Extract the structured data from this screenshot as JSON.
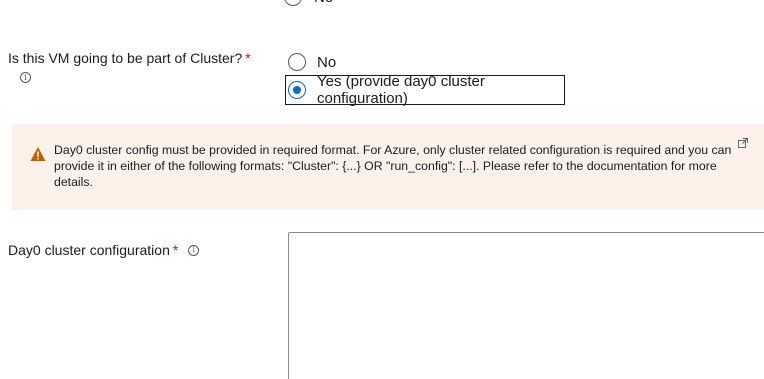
{
  "top_option": {
    "label": "No"
  },
  "cluster_question": {
    "label": "Is this VM going to be part of Cluster?",
    "required_mark": "*",
    "info_icon": "info-icon",
    "options": [
      {
        "label": "No",
        "selected": false
      },
      {
        "label": "Yes (provide day0 cluster configuration)",
        "selected": true
      }
    ]
  },
  "banner": {
    "icon": "warning-icon",
    "text": "Day0 cluster config must be provided in required format. For Azure, only cluster related configuration is required and you can provide it in either of the following formats: \"Cluster\": {...} OR \"run_config\": [...]. Please refer to the documentation for more details.",
    "link_icon": "external-link-icon",
    "background": "#fdf1e9",
    "icon_color": "#c25e00"
  },
  "day0_field": {
    "label": "Day0 cluster configuration",
    "required_mark": "*",
    "info_icon": "info-icon",
    "value": ""
  },
  "colors": {
    "accent": "#0f6cbd",
    "required": "#c50f1f"
  }
}
